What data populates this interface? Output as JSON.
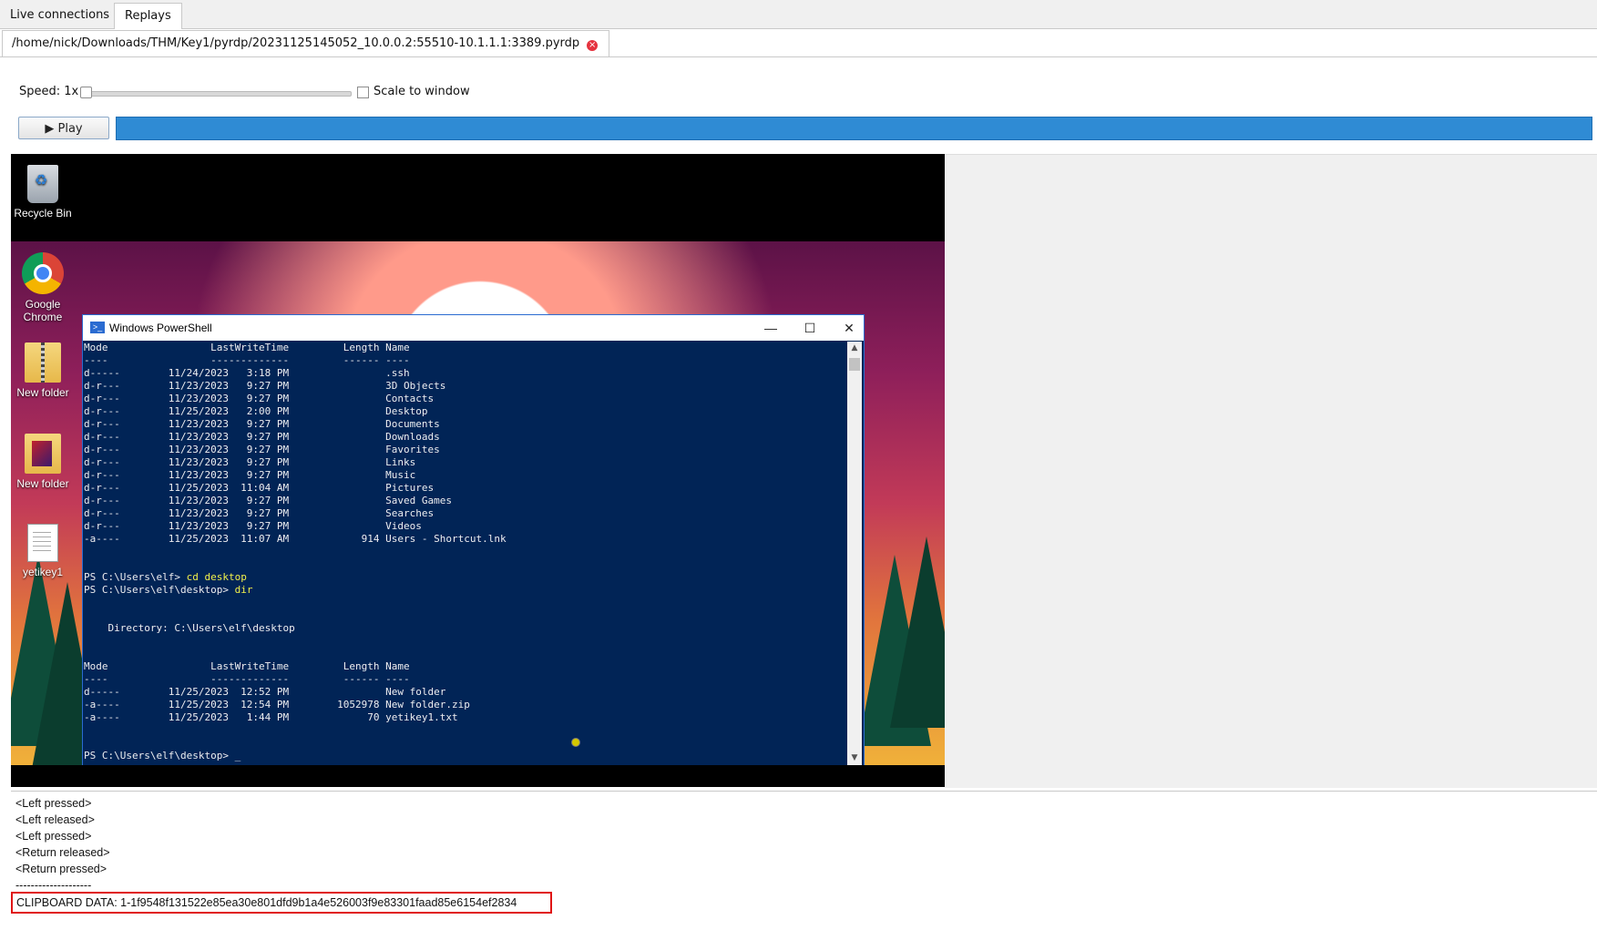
{
  "tabs": [
    {
      "label": "Live connections",
      "selected": false
    },
    {
      "label": "Replays",
      "selected": true
    }
  ],
  "file_tab": {
    "label": "/home/nick/Downloads/THM/Key1/pyrdp/20231125145052_10.0.0.2:55510-10.1.1.1:3389.pyrdp",
    "close_icon": "close-icon"
  },
  "controls": {
    "speed_label": "Speed: 1x",
    "scale_label": "Scale to window",
    "scale_checked": false,
    "play_label": "▶ Play",
    "progress": 1.0,
    "accent": "#2f8bd4"
  },
  "desktop": {
    "icons": [
      {
        "label": "Recycle Bin",
        "icon": "recycle-bin-icon"
      },
      {
        "label": "Google Chrome",
        "icon": "chrome-icon"
      },
      {
        "label": "New folder",
        "icon": "zip-folder-icon"
      },
      {
        "label": "New folder",
        "icon": "folder-icon"
      },
      {
        "label": "yetikey1",
        "icon": "text-file-icon"
      }
    ]
  },
  "powershell": {
    "title": "Windows PowerShell",
    "lines": [
      "Mode                 LastWriteTime         Length Name",
      "----                 -------------         ------ ----",
      "d-----        11/24/2023   3:18 PM                .ssh",
      "d-r---        11/23/2023   9:27 PM                3D Objects",
      "d-r---        11/23/2023   9:27 PM                Contacts",
      "d-r---        11/25/2023   2:00 PM                Desktop",
      "d-r---        11/23/2023   9:27 PM                Documents",
      "d-r---        11/23/2023   9:27 PM                Downloads",
      "d-r---        11/23/2023   9:27 PM                Favorites",
      "d-r---        11/23/2023   9:27 PM                Links",
      "d-r---        11/23/2023   9:27 PM                Music",
      "d-r---        11/25/2023  11:04 AM                Pictures",
      "d-r---        11/23/2023   9:27 PM                Saved Games",
      "d-r---        11/23/2023   9:27 PM                Searches",
      "d-r---        11/23/2023   9:27 PM                Videos",
      "-a----        11/25/2023  11:07 AM            914 Users - Shortcut.lnk",
      "",
      "",
      "PS C:\\Users\\elf> cd desktop",
      "PS C:\\Users\\elf\\desktop> dir",
      "",
      "",
      "    Directory: C:\\Users\\elf\\desktop",
      "",
      "",
      "Mode                 LastWriteTime         Length Name",
      "----                 -------------         ------ ----",
      "d-----        11/25/2023  12:52 PM                New folder",
      "-a----        11/25/2023  12:54 PM        1052978 New folder.zip",
      "-a----        11/25/2023   1:44 PM             70 yetikey1.txt",
      "",
      "",
      "PS C:\\Users\\elf\\desktop> _"
    ]
  },
  "log": {
    "events": [
      "<Left pressed>",
      "<Left released>",
      "<Left pressed>",
      "<Return released>",
      "<Return pressed>",
      "--------------------"
    ],
    "clipboard": "CLIPBOARD DATA: 1-1f9548f131522e85ea30e801dfd9b1a4e526003f9e83301faad85e6154ef2834",
    "highlight_color": "#e01515"
  }
}
